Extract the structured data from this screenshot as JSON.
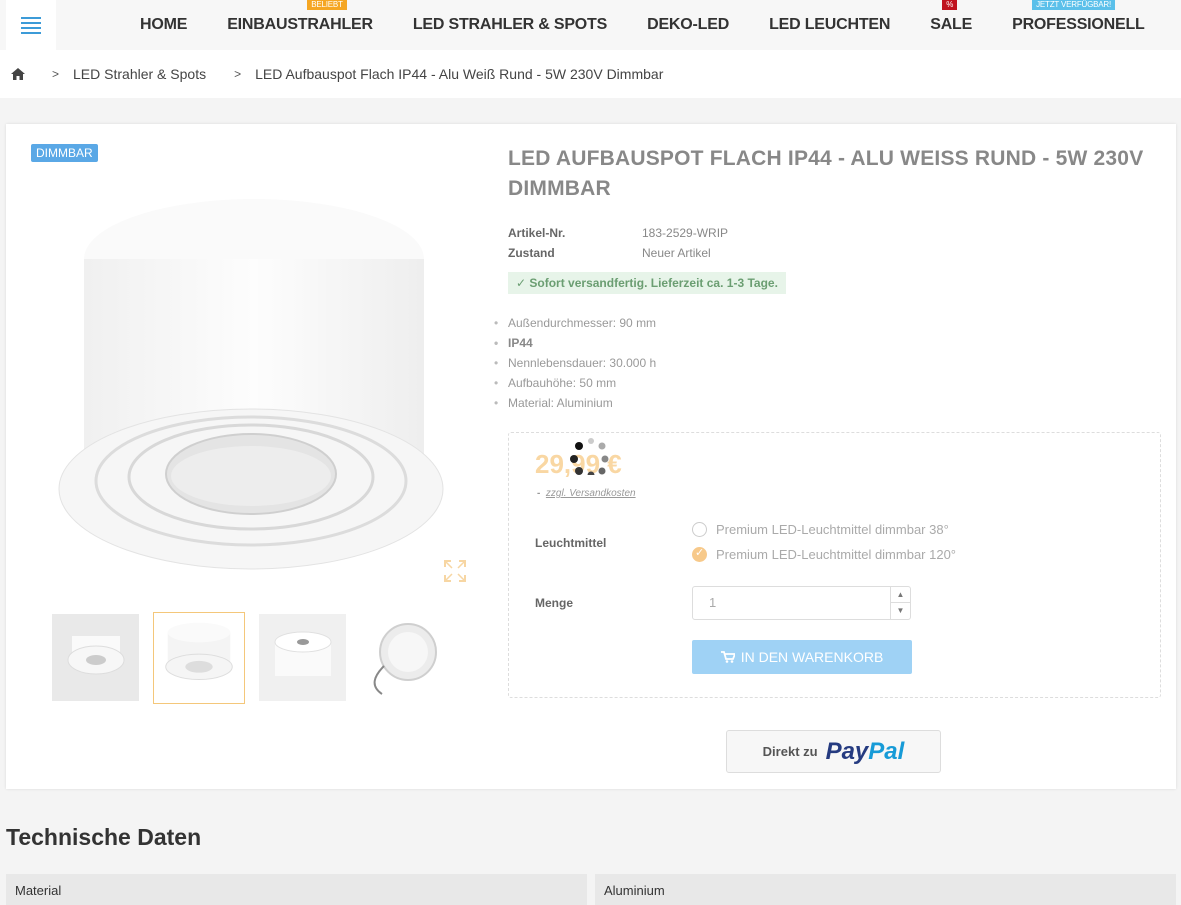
{
  "nav": {
    "items": [
      {
        "label": "HOME",
        "badge": ""
      },
      {
        "label": "EINBAUSTRAHLER",
        "badge": "BELIEBT"
      },
      {
        "label": "LED STRAHLER & SPOTS",
        "badge": ""
      },
      {
        "label": "DEKO-LED",
        "badge": ""
      },
      {
        "label": "LED LEUCHTEN",
        "badge": ""
      },
      {
        "label": "SALE",
        "badge": "%"
      },
      {
        "label": "PROFESSIONELL",
        "badge": "JETZT VERFÜGBAR!"
      }
    ]
  },
  "breadcrumb": {
    "items": [
      "LED Strahler & Spots",
      "LED Aufbauspot Flach IP44 - Alu Weiß Rund - 5W 230V Dimmbar"
    ]
  },
  "product": {
    "badge": "DIMMBAR",
    "title": "LED AUFBAUSPOT FLACH IP44 - ALU WEISS RUND - 5W 230V DIMMBAR",
    "article_label": "Artikel-Nr.",
    "article_value": "183-2529-WRIP",
    "condition_label": "Zustand",
    "condition_value": "Neuer Artikel",
    "stock": "Sofort versandfertig. Lieferzeit ca. 1-3 Tage.",
    "features": [
      "Außendurchmesser: 90 mm",
      "IP44",
      "Nennlebensdauer: 30.000 h",
      "Aufbauhöhe: 50 mm",
      "Material: Aluminium"
    ],
    "price": "29,99 €",
    "shipping_prefix": "-",
    "shipping": "zzgl. Versandkosten",
    "option_label": "Leuchtmittel",
    "options": [
      {
        "label": "Premium LED-Leuchtmittel dimmbar 38°",
        "checked": false
      },
      {
        "label": "Premium LED-Leuchtmittel dimmbar 120°",
        "checked": true
      }
    ],
    "qty_label": "Menge",
    "qty_value": "1",
    "cart_label": "IN DEN WARENKORB",
    "paypal_prefix": "Direkt zu",
    "paypal_pay": "Pay",
    "paypal_pal": "Pal"
  },
  "tech": {
    "title": "Technische Daten",
    "rows": [
      {
        "key": "Material",
        "value": "Aluminium"
      }
    ]
  },
  "colors": {
    "accent": "#3c9bd8",
    "badge_orange": "#f5a623",
    "badge_red": "#c0131f",
    "badge_blue": "#5bc0ea"
  }
}
